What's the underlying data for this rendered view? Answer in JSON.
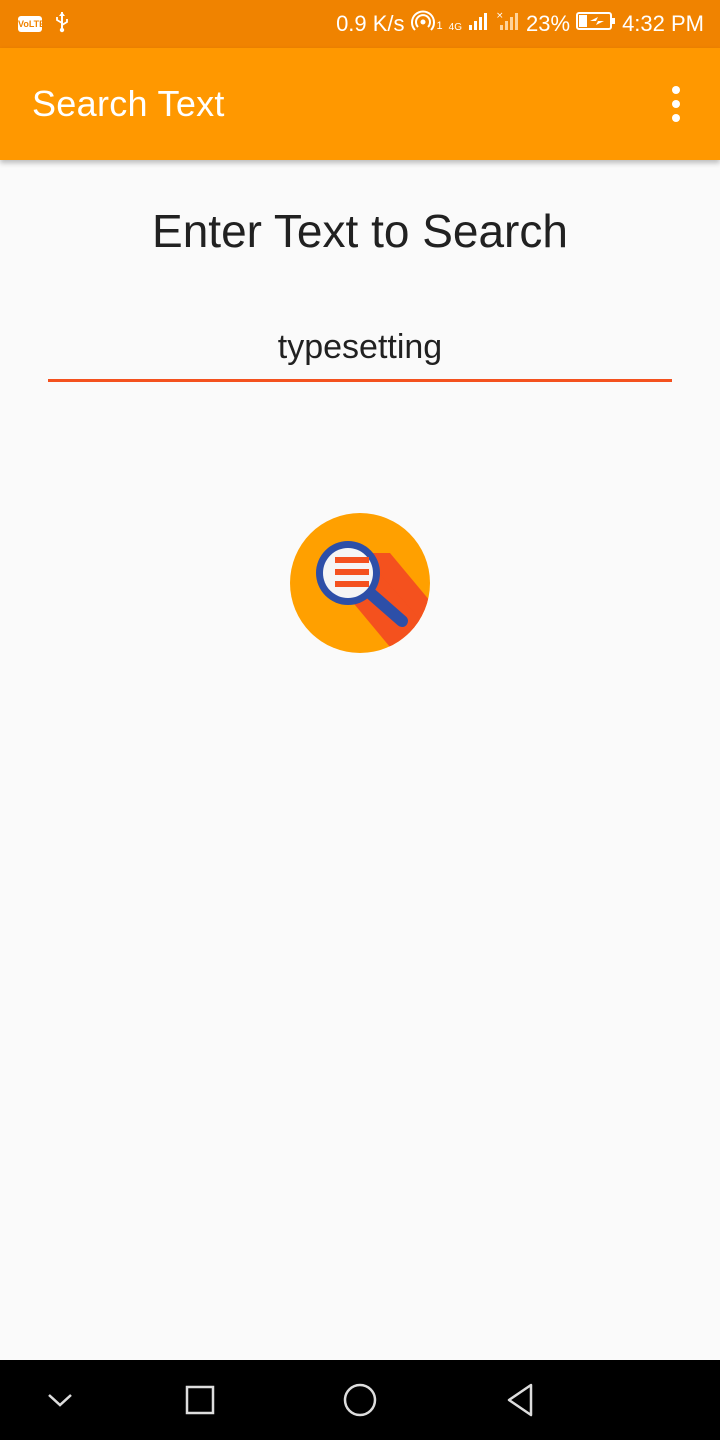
{
  "status_bar": {
    "volte_label": "VoLTE",
    "usb_icon": "usb-icon",
    "network_speed": "0.9 K/s",
    "hotspot_icon": "hotspot-icon",
    "sim1_label": "1",
    "network_type": "4G",
    "signal_icon": "signal-icon",
    "battery_percent": "23%",
    "battery_icon": "battery-charging-icon",
    "time": "4:32 PM",
    "color": "#f08300"
  },
  "app_bar": {
    "title": "Search Text",
    "menu_icon": "more-vert-icon",
    "color": "#ff9800"
  },
  "main": {
    "heading": "Enter Text to Search",
    "search_input_value": "typesetting",
    "underline_color": "#f4511e",
    "search_button_icon": "search-document-icon"
  },
  "nav_bar": {
    "buttons": [
      "collapse-icon",
      "recents-icon",
      "home-icon",
      "back-icon"
    ]
  }
}
